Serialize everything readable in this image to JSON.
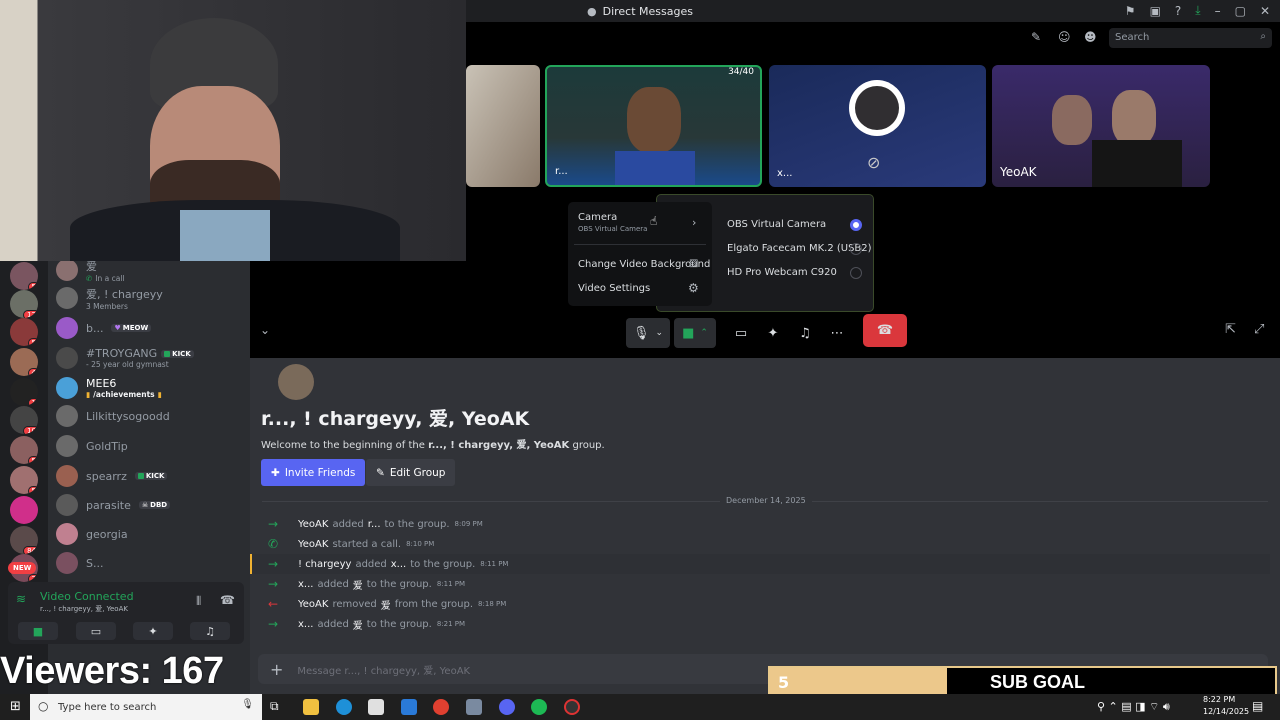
{
  "window": {
    "title": "Direct Messages"
  },
  "header": {
    "search_placeholder": "Search"
  },
  "tiles": [
    {
      "label": "r...",
      "badge": "34/40"
    },
    {
      "label": "x..."
    },
    {
      "label": "YeoAK"
    }
  ],
  "camera_menu": {
    "camera_label": "Camera",
    "camera_sub": "OBS Virtual Camera",
    "change_bg": "Change Video Background",
    "video_settings": "Video Settings",
    "options": [
      "OBS Virtual Camera",
      "Elgato Facecam MK.2 (USB2)",
      "HD Pro Webcam C920"
    ],
    "selected": "OBS Virtual Camera"
  },
  "sidebar": {
    "items": [
      {
        "name": "爱",
        "sub": "In a call"
      },
      {
        "name": "爱, ! chargeyy",
        "sub": "3 Members"
      },
      {
        "name": "b...",
        "pill": "MEOW"
      },
      {
        "name": "#TROYGANG",
        "pill": "KICK",
        "sub": "- 25 year old gymnast"
      },
      {
        "name": "MEE6",
        "pill": "/achievements"
      },
      {
        "name": "Lilkittysogoodd"
      },
      {
        "name": "GoldTip"
      },
      {
        "name": "spearrz",
        "pill": "KICK"
      },
      {
        "name": "parasite",
        "pill": "DBD"
      },
      {
        "name": "georgia"
      },
      {
        "name": "S..."
      }
    ],
    "server_badges": [
      "5",
      "12",
      "5",
      "4",
      "1",
      "10",
      "5",
      "5",
      "84",
      "2"
    ],
    "new_badge": "NEW",
    "voice": {
      "status": "Video Connected",
      "channel": "r..., ! chargeyy, 爱, YeoAK"
    }
  },
  "chat": {
    "title": "r..., ! chargeyy, 爱, YeoAK",
    "welcome_prefix": "Welcome to the beginning of the",
    "welcome_group": "r..., ! chargeyy, 爱, YeoAK",
    "welcome_suffix": "group.",
    "invite_label": "Invite Friends",
    "edit_label": "Edit Group",
    "date": "December 14, 2025",
    "messages": [
      {
        "who": "YeoAK",
        "verb": "added",
        "target": "r...",
        "rest": "to the group.",
        "time": "8:09 PM",
        "kind": "join"
      },
      {
        "who": "YeoAK",
        "verb": "started a call.",
        "target": "",
        "rest": "",
        "time": "8:10 PM",
        "kind": "call"
      },
      {
        "who": "! chargeyy",
        "verb": "added",
        "target": "x...",
        "rest": "to the group.",
        "time": "8:11 PM",
        "kind": "join"
      },
      {
        "who": "x...",
        "verb": "added",
        "target": "爱",
        "rest": "to the group.",
        "time": "8:11 PM",
        "kind": "join"
      },
      {
        "who": "YeoAK",
        "verb": "removed",
        "target": "爱",
        "rest": "from the group.",
        "time": "8:18 PM",
        "kind": "leave"
      },
      {
        "who": "x...",
        "verb": "added",
        "target": "爱",
        "rest": "to the group.",
        "time": "8:21 PM",
        "kind": "join"
      }
    ],
    "input_placeholder": "Message r..., ! chargeyy, 爱, YeoAK"
  },
  "overlay": {
    "viewers": "Viewers: 167",
    "sub_count": "5",
    "sub_goal": "SUB GOAL",
    "sub_progress": 0.35
  },
  "taskbar": {
    "search_placeholder": "Type here to search",
    "time": "8:22 PM",
    "date": "12/14/2025"
  },
  "colors": {
    "accent": "#5865f2",
    "green": "#23a55a",
    "red": "#da373c",
    "gold": "#ecc88b"
  }
}
